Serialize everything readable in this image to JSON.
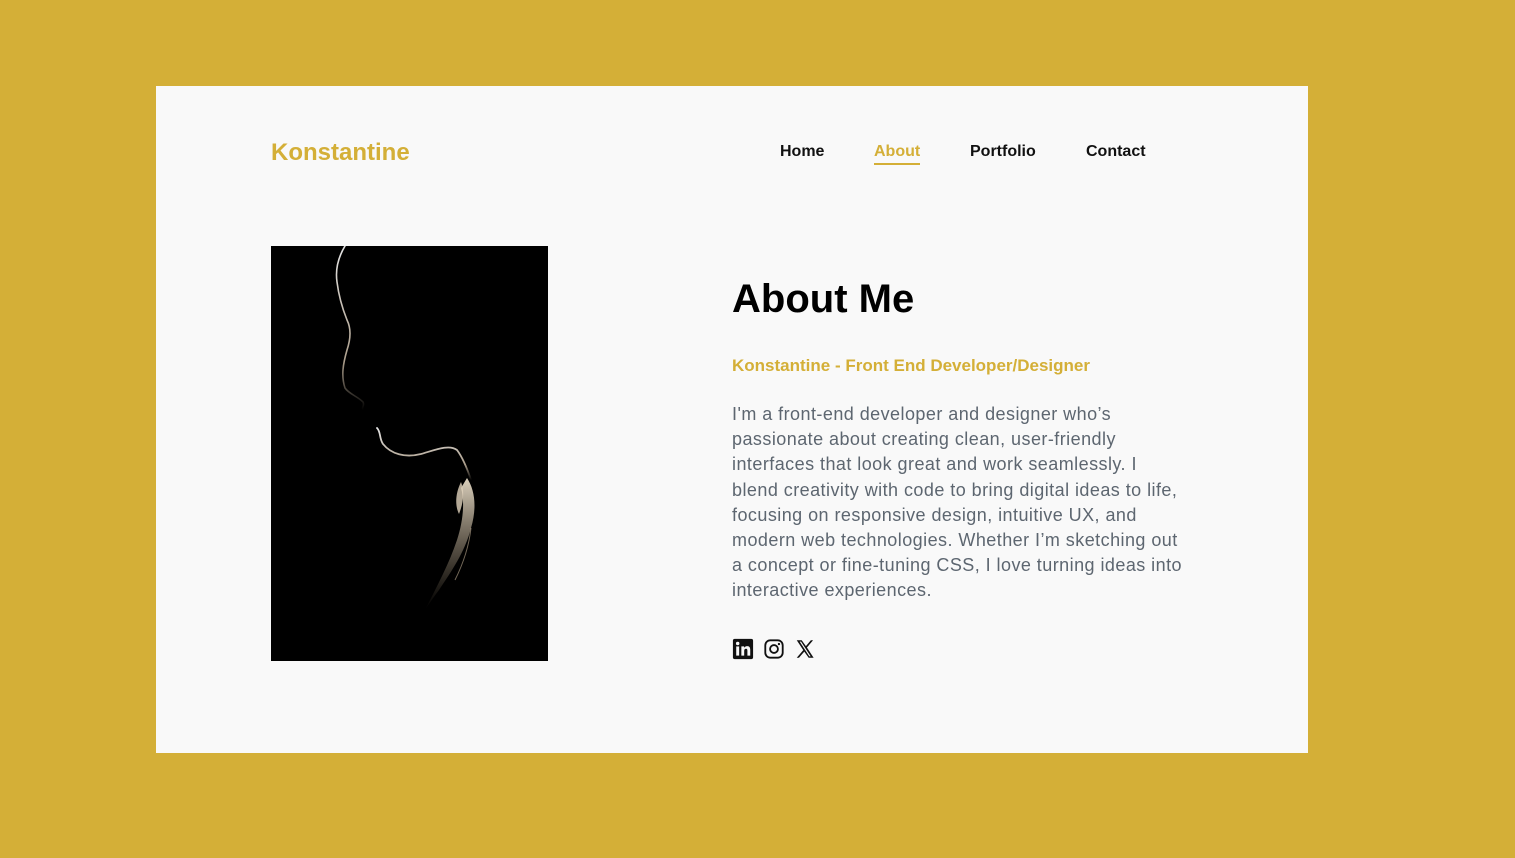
{
  "brand": {
    "name": "Konstantine"
  },
  "nav": {
    "items": [
      {
        "label": "Home"
      },
      {
        "label": "About"
      },
      {
        "label": "Portfolio"
      },
      {
        "label": "Contact"
      }
    ],
    "active": "About"
  },
  "about": {
    "heading": "About Me",
    "subheading": "Konstantine - Front End Developer/Designer",
    "bio": "I'm a front-end developer and designer who’s passionate about creating clean, user-friendly interfaces that look great and work seamlessly. I blend creativity with code to bring digital ideas to life, focusing on responsive design, intuitive UX, and modern web technologies. Whether I’m sketching out a concept or fine-tuning CSS, I love turning ideas into interactive experiences."
  },
  "photo": {
    "description_icon": "silhouette-portrait"
  },
  "socials": [
    {
      "icon": "linkedin-icon"
    },
    {
      "icon": "instagram-icon"
    },
    {
      "icon": "x-twitter-icon"
    }
  ],
  "colors": {
    "accent": "#D4AF37",
    "card": "#F9F9F9",
    "text": "#111111",
    "muted": "#5D6670"
  }
}
